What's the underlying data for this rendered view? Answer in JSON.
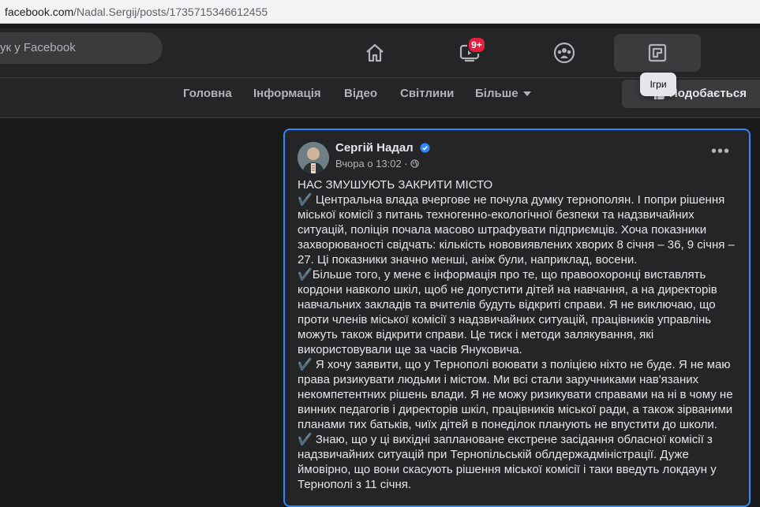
{
  "browser": {
    "url_host": "facebook.com",
    "url_path": "/Nadal.Sergij/posts/1735715346612455"
  },
  "topbar": {
    "search_placeholder": "ук у Facebook",
    "nav": [
      {
        "name": "home-icon"
      },
      {
        "name": "watch-icon",
        "badge": "9+"
      },
      {
        "name": "groups-icon"
      },
      {
        "name": "gaming-icon",
        "tooltip": "Ігри"
      }
    ]
  },
  "subnav": {
    "tabs": [
      "Головна",
      "Інформація",
      "Відео",
      "Світлини",
      "Більше"
    ],
    "like_label": "Подобається"
  },
  "post": {
    "author": "Сергій Надал",
    "timestamp": "Вчора о 13:02 ·",
    "title_line": "НАС ЗМУШУЮТЬ ЗАКРИТИ МІСТО",
    "check_glyph": "✔️",
    "paragraphs": [
      " Центральна влада вчергове не почула думку тернополян. І попри рішення міської комісії з питань техногенно-екологічної безпеки та надзвичайних ситуацій, поліція почала масово штрафувати підприємців. Хоча показники захворюваності свідчать: кількість нововиявлених хворих 8 січня – 36, 9 січня – 27. Ці показники значно менші, аніж були, наприклад, восени.",
      "Більше того, у мене є інформація про те, що правоохоронці виставлять кордони навколо шкіл, щоб не допустити дітей на навчання, а на директорів навчальних закладів та вчителів будуть відкриті справи. Я не виключаю, що проти членів міської комісії з надзвичайних ситуацій, працівників управлінь можуть також відкрити справи. Це тиск і методи залякування, які використовували ще за часів Януковича.",
      " Я хочу заявити, що у Тернополі воювати з поліцією ніхто не буде. Я не маю права ризикувати людьми і містом. Ми всі стали заручниками нав'язаних некомпетентних рішень влади. Я не можу ризикувати справами на ні в чому не винних педагогів і директорів шкіл, працівників міської ради, а також зірваними планами тих батьків, чиїх дітей в понеділок планують не впустити до школи.",
      " Знаю, що у ці вихідні заплановане екстрене засідання обласної комісії з надзвичайних ситуацій при Тернопільській облдержадміністрації. Дуже ймовірно, що вони скасують рішення міської комісії і таки введуть локдаун у Тернополі з 11 січня."
    ]
  }
}
